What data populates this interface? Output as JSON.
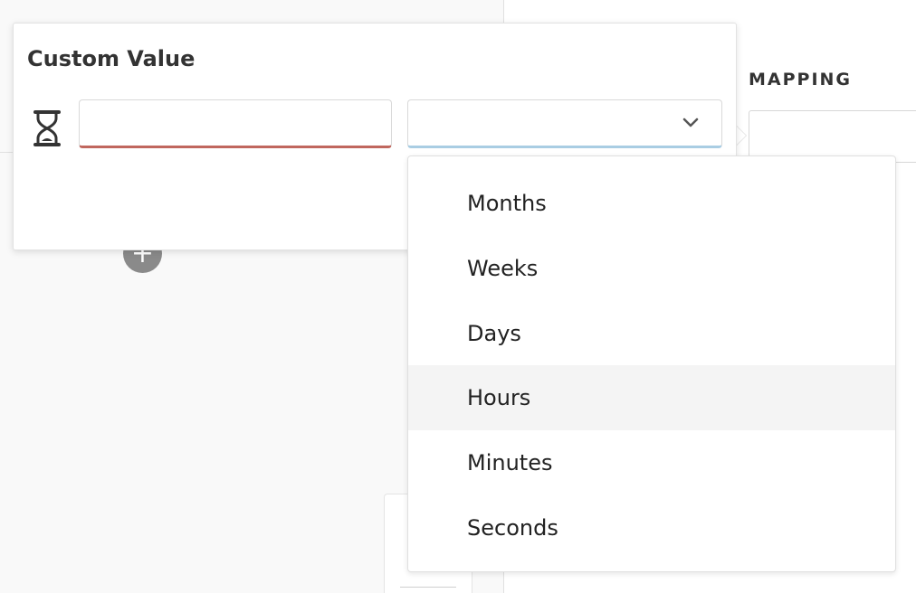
{
  "popover": {
    "title": "Custom Value",
    "icon": "hourglass-icon",
    "value_input": {
      "value": "",
      "placeholder": ""
    },
    "unit_select": {
      "selected": ""
    }
  },
  "unit_options": [
    "Months",
    "Weeks",
    "Days",
    "Hours",
    "Minutes",
    "Seconds"
  ],
  "highlighted_option": "Hours",
  "mapping": {
    "label": "MAPPING"
  },
  "add_node": {
    "glyph": "+"
  },
  "colors": {
    "error_underline": "#c0675e",
    "focus_underline": "#a9cde3",
    "option_hover_bg": "#f4f4f4",
    "canvas_bg": "#f9f9f9"
  }
}
